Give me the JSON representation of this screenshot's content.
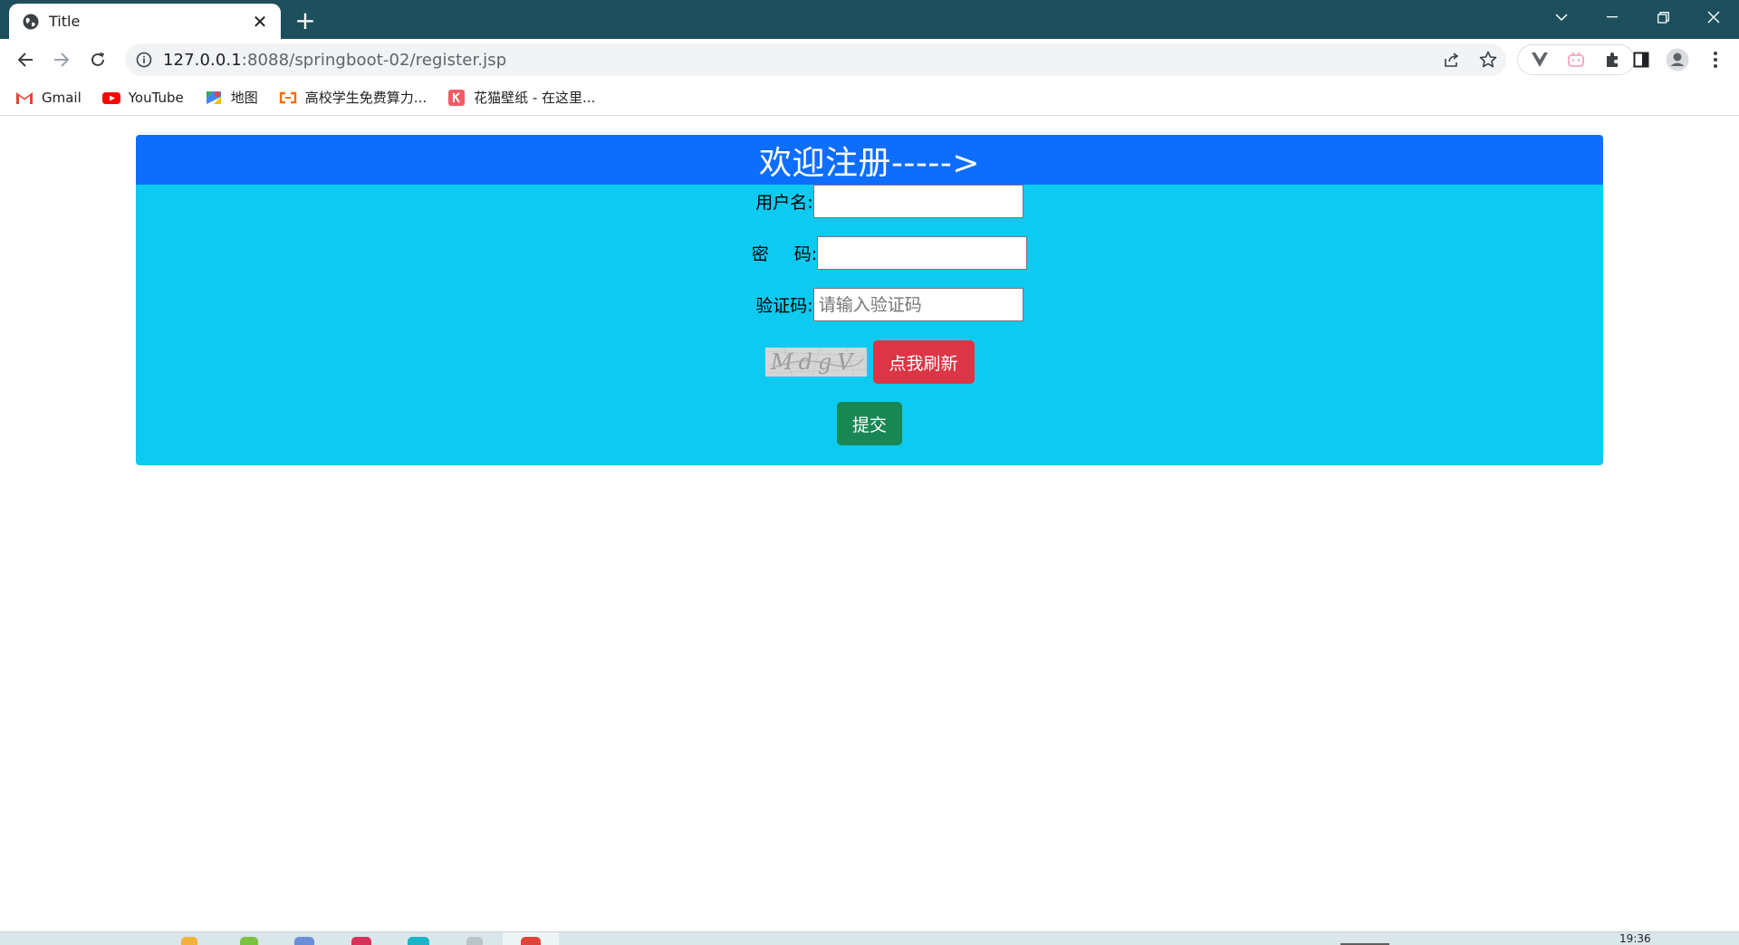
{
  "browser": {
    "tab": {
      "title": "Title",
      "close_glyph": "✕",
      "favicon": "globe-icon"
    },
    "new_tab_glyph": "+",
    "window_controls": [
      "tab-search-icon",
      "minimize-icon",
      "restore-icon",
      "close-icon"
    ],
    "address_bar": {
      "url_host": "127.0.0.1",
      "url_rest": ":8088/springboot-02/register.jsp",
      "info_icon": "info-icon"
    },
    "theme_color": "#1d4f5c"
  },
  "bookmarks": [
    {
      "label": "Gmail",
      "icon": "gmail-icon"
    },
    {
      "label": "YouTube",
      "icon": "youtube-icon"
    },
    {
      "label": "地图",
      "icon": "maps-icon"
    },
    {
      "label": "高校学生免费算力...",
      "icon": "aliyun-icon"
    },
    {
      "label": "花猫壁纸 - 在这里...",
      "icon": "huamao-icon"
    }
  ],
  "register": {
    "title": "欢迎注册----->",
    "username_label": "用户名:",
    "username_value": "",
    "password_label_1": "密",
    "password_label_2": "码:",
    "password_value": "",
    "code_label": "验证码:",
    "code_placeholder": "请输入验证码",
    "captcha_text": "MdgV",
    "refresh_label": "点我刷新",
    "submit_label": "提交",
    "colors": {
      "header": "#0d6efd",
      "body": "#0dcaf0",
      "danger": "#dc3545",
      "success": "#198754"
    }
  },
  "taskbar": {
    "clock": "19:36"
  }
}
